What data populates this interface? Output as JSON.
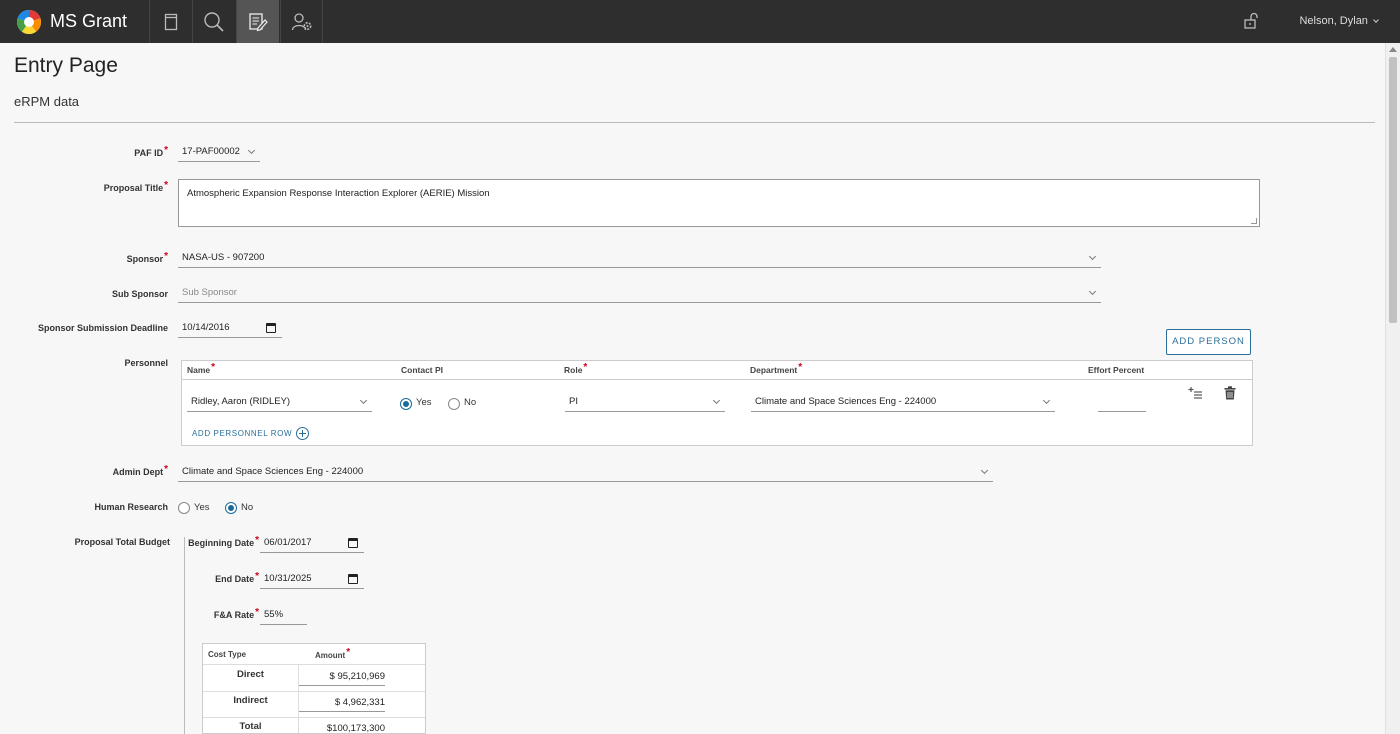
{
  "app": {
    "name": "MS Grant",
    "user": "Nelson, Dylan"
  },
  "nav": {
    "items": [
      "docs",
      "search",
      "entry",
      "admin"
    ]
  },
  "page": {
    "title": "Entry Page",
    "subtitle": "eRPM data"
  },
  "form": {
    "paf_id": {
      "label": "PAF ID",
      "value": "17-PAF00002"
    },
    "proposal_title": {
      "label": "Proposal Title",
      "value": "Atmospheric Expansion Response Interaction Explorer (AERIE) Mission"
    },
    "sponsor": {
      "label": "Sponsor",
      "value": "NASA-US - 907200"
    },
    "sub_sponsor": {
      "label": "Sub Sponsor",
      "placeholder": "Sub Sponsor"
    },
    "deadline": {
      "label": "Sponsor Submission Deadline",
      "value": "10/14/2016"
    },
    "add_person_label": "ADD PERSON",
    "personnel": {
      "label": "Personnel",
      "headers": {
        "name": "Name",
        "contact_pi": "Contact PI",
        "role": "Role",
        "department": "Department",
        "effort": "Effort Percent"
      },
      "row": {
        "name": "Ridley, Aaron (RIDLEY)",
        "contact_yes": "Yes",
        "contact_no": "No",
        "contact_selected": "Yes",
        "role": "PI",
        "department": "Climate and Space Sciences Eng - 224000",
        "effort": ""
      },
      "add_row_label": "ADD PERSONNEL ROW"
    },
    "admin_dept": {
      "label": "Admin Dept",
      "value": "Climate and Space Sciences Eng - 224000"
    },
    "human_research": {
      "label": "Human Research",
      "yes": "Yes",
      "no": "No",
      "selected": "No"
    },
    "budget": {
      "label": "Proposal Total Budget",
      "beginning_date": {
        "label": "Beginning Date",
        "value": "06/01/2017"
      },
      "end_date": {
        "label": "End Date",
        "value": "10/31/2025"
      },
      "fa_rate": {
        "label": "F&A Rate",
        "value": "55%"
      },
      "cost_headers": {
        "type": "Cost Type",
        "amount": "Amount"
      },
      "costs": [
        {
          "type": "Direct",
          "amount": "$ 95,210,969"
        },
        {
          "type": "Indirect",
          "amount": "$ 4,962,331"
        },
        {
          "type": "Total",
          "amount": "$100,173,300"
        }
      ]
    }
  }
}
